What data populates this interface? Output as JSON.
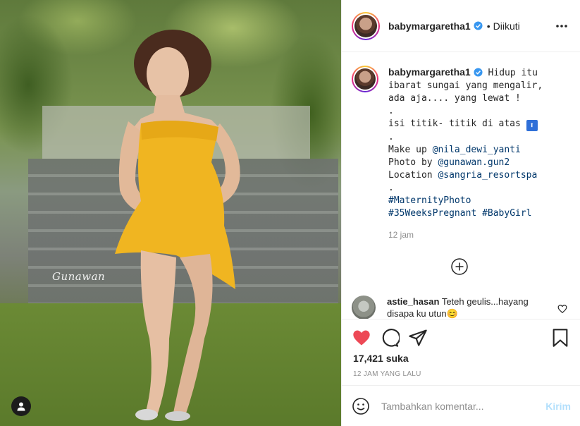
{
  "post": {
    "username": "babymargaretha1",
    "follow_separator": "•",
    "follow_state": "Diikuti",
    "photo_watermark": "Gunawan"
  },
  "caption": {
    "username": "babymargaretha1",
    "line1": "Hidup itu ibarat sungai yang mengalir, ada aja.... yang lewat !",
    "dot1": ".",
    "line2": "isi titik- titik di atas",
    "dot2": ".",
    "makeup_prefix": "Make up ",
    "makeup_handle": "@nila_dewi_yanti",
    "photo_prefix": "Photo by ",
    "photo_handle": "@gunawan.gun2",
    "location_prefix": "Location ",
    "location_handle": "@sangria_resortspa",
    "dot3": ".",
    "hashtag1": "#MaternityPhoto",
    "hashtag2": "#35WeeksPregnant",
    "hashtag3": "#BabyGirl",
    "time": "12 jam"
  },
  "comment": {
    "username": "astie_hasan",
    "text": "Teteh geulis...hayang disapa ku utun😊"
  },
  "stats": {
    "likes": "17,421 suka",
    "timestamp": "12 JAM YANG LALU"
  },
  "composer": {
    "placeholder": "Tambahkan komentar...",
    "post_label": "Kirim"
  },
  "colors": {
    "like_red": "#ed4956",
    "link_blue": "#00376b",
    "verified_blue": "#3897f0",
    "post_disabled": "#b2dffc"
  },
  "icons": {
    "more": "more-options-icon",
    "like": "heart-icon",
    "comment": "comment-icon",
    "share": "share-icon",
    "save": "bookmark-icon",
    "emoji": "emoji-icon",
    "load_more": "plus-circle-icon",
    "tag": "user-tag-icon"
  }
}
